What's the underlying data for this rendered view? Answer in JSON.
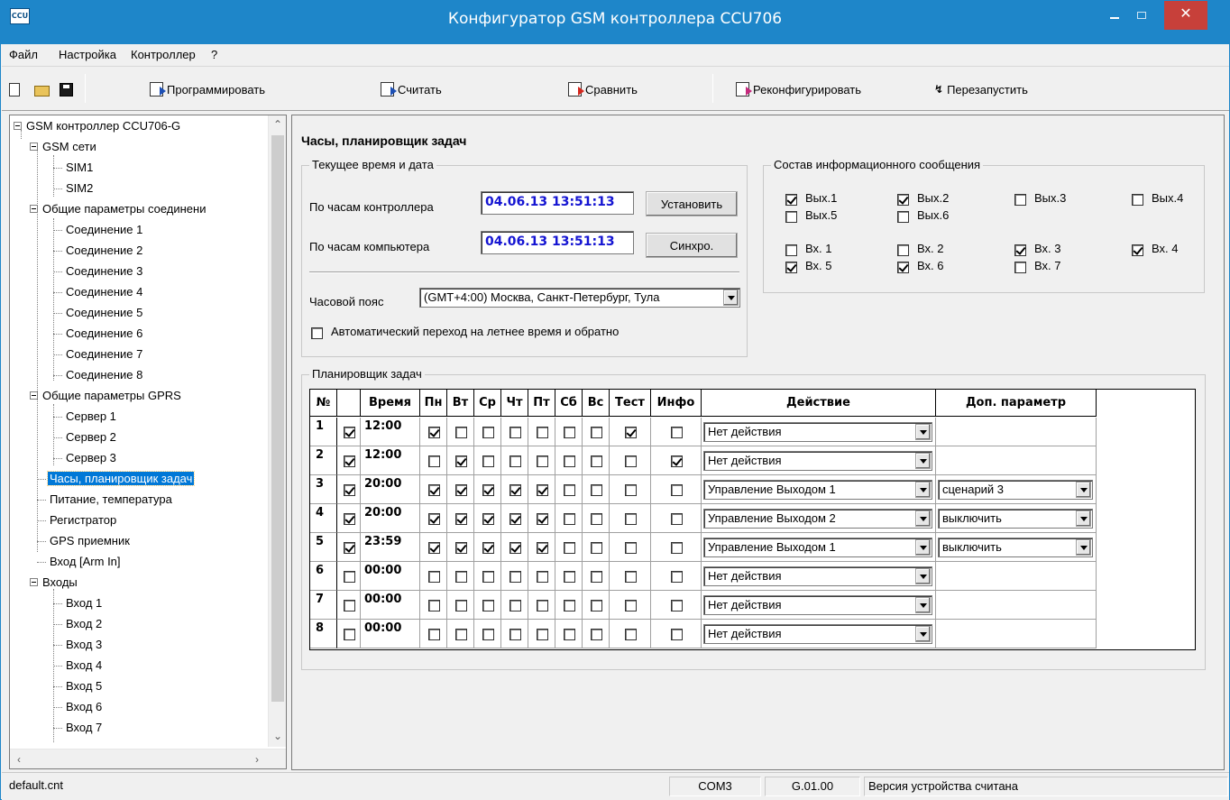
{
  "window": {
    "title": "Конфигуратор GSM контроллера CCU706",
    "icon_text": "CCU"
  },
  "menu": [
    "Файл",
    "Настройка",
    "Контроллер",
    "?"
  ],
  "toolbar": {
    "program": "Программировать",
    "read": "Считать",
    "compare": "Сравнить",
    "reconfigure": "Реконфигурировать",
    "restart": "Перезапустить"
  },
  "tree": {
    "root": "GSM контроллер CCU706-G",
    "gsm": "GSM сети",
    "sim1": "SIM1",
    "sim2": "SIM2",
    "conn_params": "Общие параметры соединени",
    "connections": [
      "Соединение 1",
      "Соединение 2",
      "Соединение 3",
      "Соединение 4",
      "Соединение 5",
      "Соединение 6",
      "Соединение 7",
      "Соединение 8"
    ],
    "gprs": "Общие параметры GPRS",
    "servers": [
      "Сервер 1",
      "Сервер 2",
      "Сервер 3"
    ],
    "clock": "Часы, планировщик задач",
    "power": "Питание, температура",
    "recorder": "Регистратор",
    "gps": "GPS приемник",
    "arm": "Вход [Arm In]",
    "inputs": "Входы",
    "input_items": [
      "Вход 1",
      "Вход 2",
      "Вход 3",
      "Вход 4",
      "Вход 5",
      "Вход 6",
      "Вход 7"
    ]
  },
  "main": {
    "title": "Часы, планировщик задач",
    "time_group": {
      "legend": "Текущее время и дата",
      "controller_label": "По часам контроллера",
      "controller_value": "04.06.13 13:51:13",
      "set_button": "Установить",
      "pc_label": "По часам компьютера",
      "pc_value": "04.06.13 13:51:13",
      "sync_button": "Синхро.",
      "tz_label": "Часовой пояс",
      "tz_value": "(GMT+4:00) Москва, Санкт-Петербург, Тула",
      "dst_label": "Автоматический переход на летнее время и обратно",
      "dst_checked": false
    },
    "info_group": {
      "legend": "Состав информационного сообщения",
      "outputs": [
        {
          "label": "Вых.1",
          "checked": true
        },
        {
          "label": "Вых.2",
          "checked": true
        },
        {
          "label": "Вых.3",
          "checked": false
        },
        {
          "label": "Вых.4",
          "checked": false
        },
        {
          "label": "Вых.5",
          "checked": false
        },
        {
          "label": "Вых.6",
          "checked": false
        }
      ],
      "inputs": [
        {
          "label": "Вх. 1",
          "checked": false
        },
        {
          "label": "Вх. 2",
          "checked": false
        },
        {
          "label": "Вх. 3",
          "checked": true
        },
        {
          "label": "Вх. 4",
          "checked": true
        },
        {
          "label": "Вх. 5",
          "checked": true
        },
        {
          "label": "Вх. 6",
          "checked": true
        },
        {
          "label": "Вх. 7",
          "checked": false
        }
      ]
    },
    "scheduler": {
      "legend": "Планировщик задач",
      "headers": [
        "№",
        "",
        "Время",
        "Пн",
        "Вт",
        "Ср",
        "Чт",
        "Пт",
        "Сб",
        "Вс",
        "Тест",
        "Инфо",
        "Действие",
        "Доп. параметр"
      ],
      "rows": [
        {
          "n": "1",
          "en": true,
          "time": "12:00",
          "days": [
            true,
            false,
            false,
            false,
            false,
            false,
            false
          ],
          "test": true,
          "info": false,
          "action": "Нет действия",
          "param": ""
        },
        {
          "n": "2",
          "en": true,
          "time": "12:00",
          "days": [
            false,
            true,
            false,
            false,
            false,
            false,
            false
          ],
          "test": false,
          "info": true,
          "action": "Нет действия",
          "param": ""
        },
        {
          "n": "3",
          "en": true,
          "time": "20:00",
          "days": [
            true,
            true,
            true,
            true,
            true,
            false,
            false
          ],
          "test": false,
          "info": false,
          "action": "Управление Выходом 1",
          "param": "сценарий 3"
        },
        {
          "n": "4",
          "en": true,
          "time": "20:00",
          "days": [
            true,
            true,
            true,
            true,
            true,
            false,
            false
          ],
          "test": false,
          "info": false,
          "action": "Управление Выходом 2",
          "param": "выключить"
        },
        {
          "n": "5",
          "en": true,
          "time": "23:59",
          "days": [
            true,
            true,
            true,
            true,
            true,
            false,
            false
          ],
          "test": false,
          "info": false,
          "action": "Управление Выходом 1",
          "param": "выключить"
        },
        {
          "n": "6",
          "en": false,
          "time": "00:00",
          "days": [
            false,
            false,
            false,
            false,
            false,
            false,
            false
          ],
          "test": false,
          "info": false,
          "action": "Нет действия",
          "param": ""
        },
        {
          "n": "7",
          "en": false,
          "time": "00:00",
          "days": [
            false,
            false,
            false,
            false,
            false,
            false,
            false
          ],
          "test": false,
          "info": false,
          "action": "Нет действия",
          "param": ""
        },
        {
          "n": "8",
          "en": false,
          "time": "00:00",
          "days": [
            false,
            false,
            false,
            false,
            false,
            false,
            false
          ],
          "test": false,
          "info": false,
          "action": "Нет действия",
          "param": ""
        }
      ]
    }
  },
  "status": {
    "file": "default.cnt",
    "port": "COM3",
    "version": "G.01.00",
    "message": "Версия устройства считана"
  },
  "colors": {
    "titlebar": "#1e86c9",
    "close": "#c7403a",
    "selection": "#0078d7",
    "time_text": "#1414d2"
  }
}
